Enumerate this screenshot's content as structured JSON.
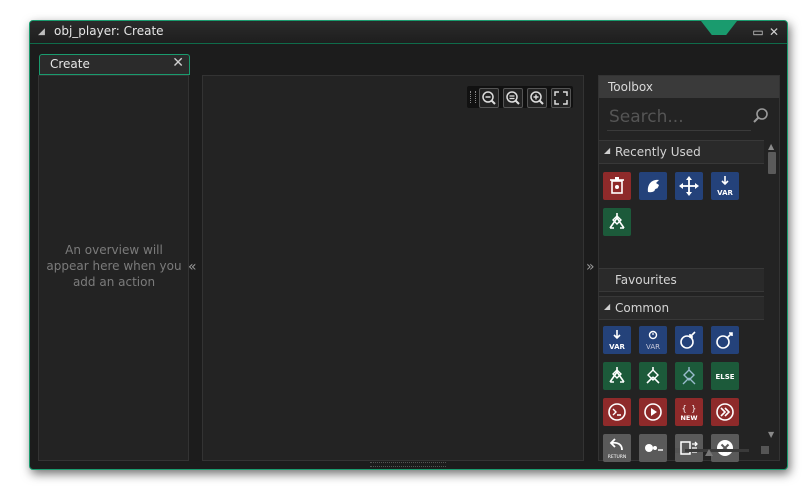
{
  "window": {
    "title": "obj_player: Create",
    "accent_color": "#1a9b6e"
  },
  "tab": {
    "label": "Create"
  },
  "left_panel": {
    "overview_text": "An overview will appear here when you add an action"
  },
  "collapse_left_glyph": "«",
  "expand_right_glyph": "»",
  "toolbox": {
    "title": "Toolbox",
    "search_placeholder": "Search...",
    "sections": {
      "recently_used": "Recently Used",
      "favourites": "Favourites",
      "common": "Common"
    },
    "recently_used_actions": [
      {
        "icon": "destroy-instance-icon",
        "color": "red"
      },
      {
        "icon": "create-instance-icon",
        "color": "blue"
      },
      {
        "icon": "move-icon",
        "color": "blue"
      },
      {
        "icon": "assign-variable-icon",
        "color": "blue"
      },
      {
        "icon": "if-variable-icon",
        "color": "green"
      }
    ],
    "common_actions": [
      {
        "icon": "assign-variable-icon",
        "color": "blue"
      },
      {
        "icon": "declare-temp-icon",
        "color": "blue"
      },
      {
        "icon": "get-instance-variable-icon",
        "color": "blue"
      },
      {
        "icon": "set-instance-variable-icon",
        "color": "blue"
      },
      {
        "icon": "if-variable-icon",
        "color": "green"
      },
      {
        "icon": "if-undefined-icon",
        "color": "green"
      },
      {
        "icon": "if-expression-icon",
        "color": "green"
      },
      {
        "icon": "else-icon",
        "color": "green",
        "label": "ELSE"
      },
      {
        "icon": "function-call-icon",
        "color": "red"
      },
      {
        "icon": "execute-script-icon",
        "color": "red"
      },
      {
        "icon": "new-struct-icon",
        "color": "red",
        "label": "NEW"
      },
      {
        "icon": "run-icon",
        "color": "red"
      },
      {
        "icon": "return-icon",
        "color": "gray",
        "label": "RETURN"
      },
      {
        "icon": "comment-icon",
        "color": "gray"
      },
      {
        "icon": "exit-event-icon",
        "color": "gray"
      },
      {
        "icon": "break-icon",
        "color": "gray"
      }
    ],
    "var_label": "VAR"
  }
}
